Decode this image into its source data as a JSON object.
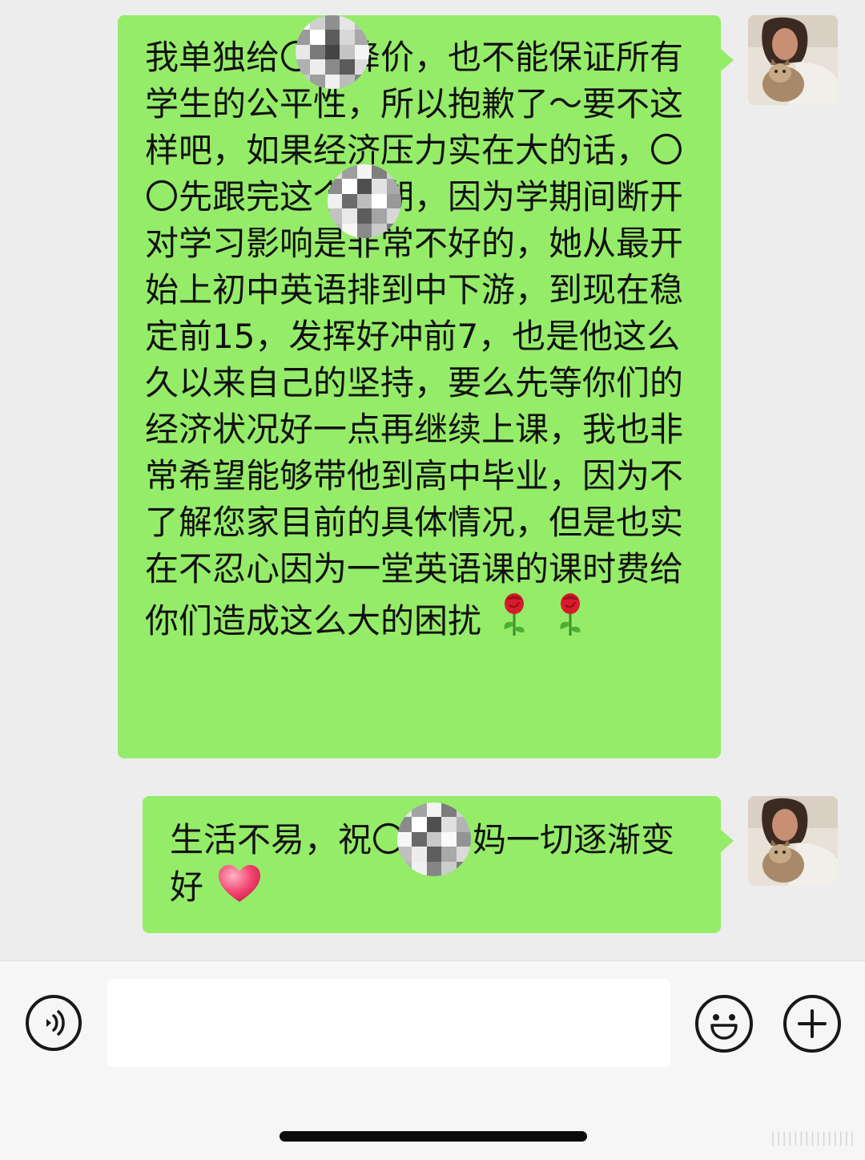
{
  "messages": [
    {
      "sender": "self",
      "text": "我单独给〇〇降价，也不能保证所有学生的公平性，所以抱歉了～要不这样吧，如果经济压力实在大的话，〇〇先跟完这个学期，因为学期间断开对学习影响是非常不好的，她从最开始上初中英语排到中下游，到现在稳定前15，发挥好冲前7，也是他这么久以来自己的坚持，要么先等你们的经济状况好一点再继续上课，我也非常希望能够带他到高中毕业，因为不了解您家目前的具体情况，但是也实在不忍心因为一堂英语课的课时费给你们造成这么大的困扰",
      "emojis": [
        "rose-emoji",
        "rose-emoji"
      ]
    },
    {
      "sender": "self",
      "text": "生活不易，祝〇〇妈妈一切逐渐变好",
      "emojis": [
        "heart-emoji"
      ]
    }
  ],
  "input_bar": {
    "placeholder": "",
    "voice_icon": "voice-icon",
    "emoji_icon": "smiley-icon",
    "more_icon": "plus-icon",
    "watermark": "|||||||||||||||"
  },
  "colors": {
    "bubble": "#95ec69",
    "background": "#ededed",
    "input_bar": "#f6f6f6"
  }
}
